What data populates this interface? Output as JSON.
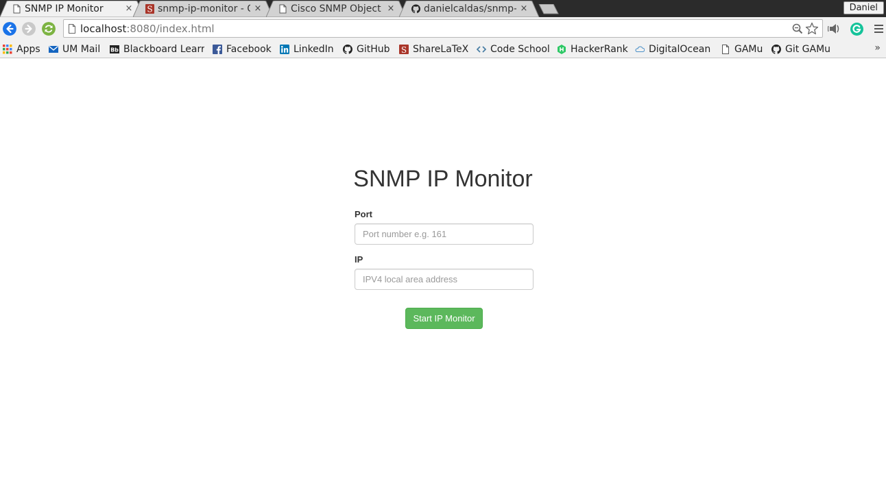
{
  "browser": {
    "tabs": [
      {
        "title": "SNMP IP Monitor",
        "icon": "page-icon",
        "active": true
      },
      {
        "title": "snmp-ip-monitor - O",
        "icon": "sharelatex-icon",
        "active": false
      },
      {
        "title": "Cisco SNMP Object N",
        "icon": "page-icon",
        "active": false
      },
      {
        "title": "danielcaldas/snmp-i",
        "icon": "github-icon",
        "active": false
      }
    ],
    "tab_close": "×",
    "profile_name": "Daniel",
    "address": {
      "host": "localhost",
      "rest": ":8080/index.html"
    },
    "bookmarks": [
      {
        "label": "Apps",
        "icon": "apps-grid-icon"
      },
      {
        "label": "UM Mail",
        "icon": "mail-icon"
      },
      {
        "label": "Blackboard Learr",
        "icon": "blackboard-icon"
      },
      {
        "label": "Facebook",
        "icon": "facebook-icon"
      },
      {
        "label": "LinkedIn",
        "icon": "linkedin-icon"
      },
      {
        "label": "GitHub",
        "icon": "github-icon"
      },
      {
        "label": "ShareLaTeX",
        "icon": "sharelatex-icon"
      },
      {
        "label": "Code School",
        "icon": "codeschool-icon"
      },
      {
        "label": "HackerRank",
        "icon": "hackerrank-icon"
      },
      {
        "label": "DigitalOcean",
        "icon": "digitalocean-icon"
      },
      {
        "label": "GAMu",
        "icon": "page-icon"
      },
      {
        "label": "Git GAMu",
        "icon": "github-icon"
      }
    ],
    "bookmarks_overflow": "»"
  },
  "page": {
    "title": "SNMP IP Monitor",
    "port": {
      "label": "Port",
      "placeholder": "Port number e.g. 161",
      "value": ""
    },
    "ip": {
      "label": "IP",
      "placeholder": "IPV4 local area address",
      "value": ""
    },
    "submit_label": "Start IP Monitor"
  },
  "colors": {
    "primary_button": "#5cb85c",
    "back_button": "#1a73e8",
    "reload_button": "#7cb342",
    "grammarly": "#15c39a"
  }
}
